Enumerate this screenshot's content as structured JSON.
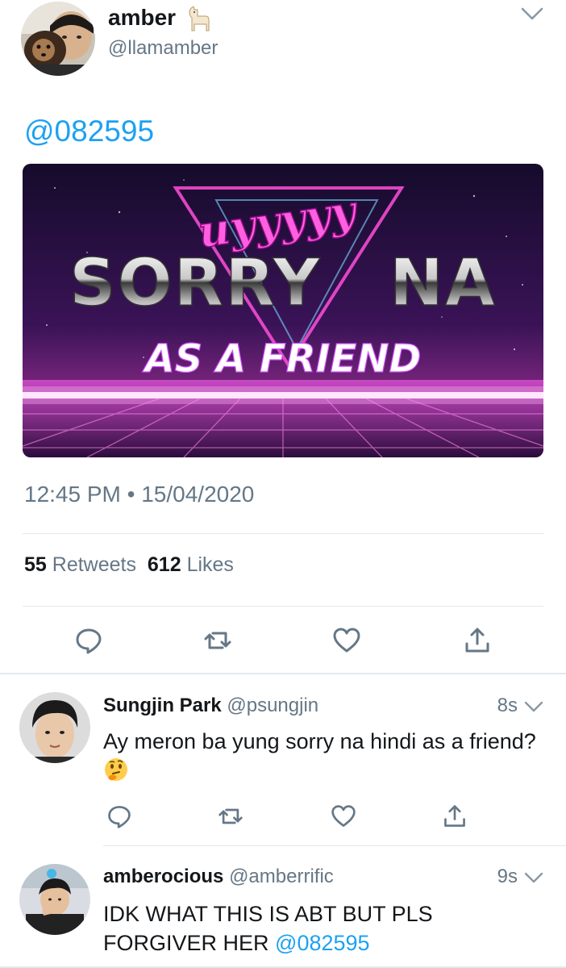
{
  "tweet": {
    "author_name": "amber",
    "author_handle": "@llamamber",
    "text_mention": "@082595",
    "image_text": {
      "top_script": "uyyyyy",
      "title_left": "SORRY",
      "title_right": "NA",
      "subtitle": "AS A FRIEND"
    },
    "time": "12:45 PM",
    "date_separator": "•",
    "date": "15/04/2020",
    "retweets_count": "55",
    "retweets_label": "Retweets",
    "likes_count": "612",
    "likes_label": "Likes"
  },
  "replies": [
    {
      "name": "Sungjin Park",
      "handle": "@psungjin",
      "time": "8s",
      "text": "Ay meron ba yung sorry na hindi as a friend?",
      "emoji": "thinking-face-emoji"
    },
    {
      "name": "amberocious",
      "handle": "@amberrific",
      "time": "9s",
      "text": "IDK WHAT THIS IS ABT BUT PLS FORGIVER HER",
      "mention": "@082595"
    }
  ],
  "icons": [
    "reply-icon",
    "retweet-icon",
    "like-icon",
    "share-icon",
    "chevron-down-icon",
    "llama-emoji"
  ],
  "colors": {
    "link": "#1da1f2",
    "muted": "#657786",
    "icon": "#657786",
    "divider": "#e1e8ed"
  }
}
